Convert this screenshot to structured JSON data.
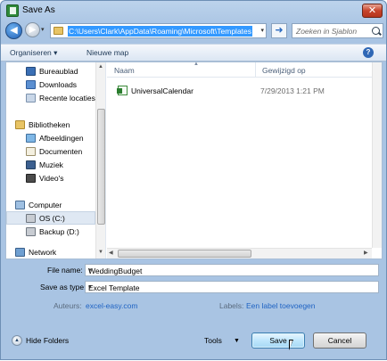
{
  "window": {
    "title": "Save As",
    "close": "✕"
  },
  "nav": {
    "back": "◀",
    "forward": "▶",
    "dropdown": "▾",
    "go": "➜"
  },
  "address": {
    "path": "C:\\Users\\Clark\\AppData\\Roaming\\Microsoft\\Templates",
    "dropdown": "▾"
  },
  "search": {
    "placeholder": "Zoeken in Sjablon"
  },
  "toolbar": {
    "organize": "Organiseren ▾",
    "new_folder": "Nieuwe map",
    "help": "?"
  },
  "sidebar": {
    "items": [
      {
        "label": "Bureaublad",
        "icon": "desktop-icon"
      },
      {
        "label": "Downloads",
        "icon": "downloads-icon"
      },
      {
        "label": "Recente locaties",
        "icon": "recent-places-icon"
      },
      {
        "label": "Bibliotheken",
        "icon": "libraries-icon"
      },
      {
        "label": "Afbeeldingen",
        "icon": "pictures-icon"
      },
      {
        "label": "Documenten",
        "icon": "documents-icon"
      },
      {
        "label": "Muziek",
        "icon": "music-icon"
      },
      {
        "label": "Video's",
        "icon": "videos-icon"
      },
      {
        "label": "Computer",
        "icon": "computer-icon"
      },
      {
        "label": "OS (C:)",
        "icon": "drive-icon"
      },
      {
        "label": "Backup (D:)",
        "icon": "drive-icon"
      },
      {
        "label": "Network",
        "icon": "network-icon"
      }
    ]
  },
  "filelist": {
    "col_name": "Naam",
    "col_date": "Gewijzigd op",
    "files": [
      {
        "name": "UniversalCalendar",
        "date": "7/29/2013 1:21 PM"
      }
    ]
  },
  "form": {
    "filename_label": "File name:",
    "filename_value": "WeddingBudget",
    "savetype_label": "Save as type:",
    "savetype_value": "Excel Template",
    "authors_label": "Auteurs:",
    "authors_value": "excel-easy.com",
    "labels_label": "Labels:",
    "labels_value": "Een label toevoegen"
  },
  "footer": {
    "hide_folders": "Hide Folders",
    "tools": "Tools",
    "save": "Save",
    "cancel": "Cancel"
  }
}
